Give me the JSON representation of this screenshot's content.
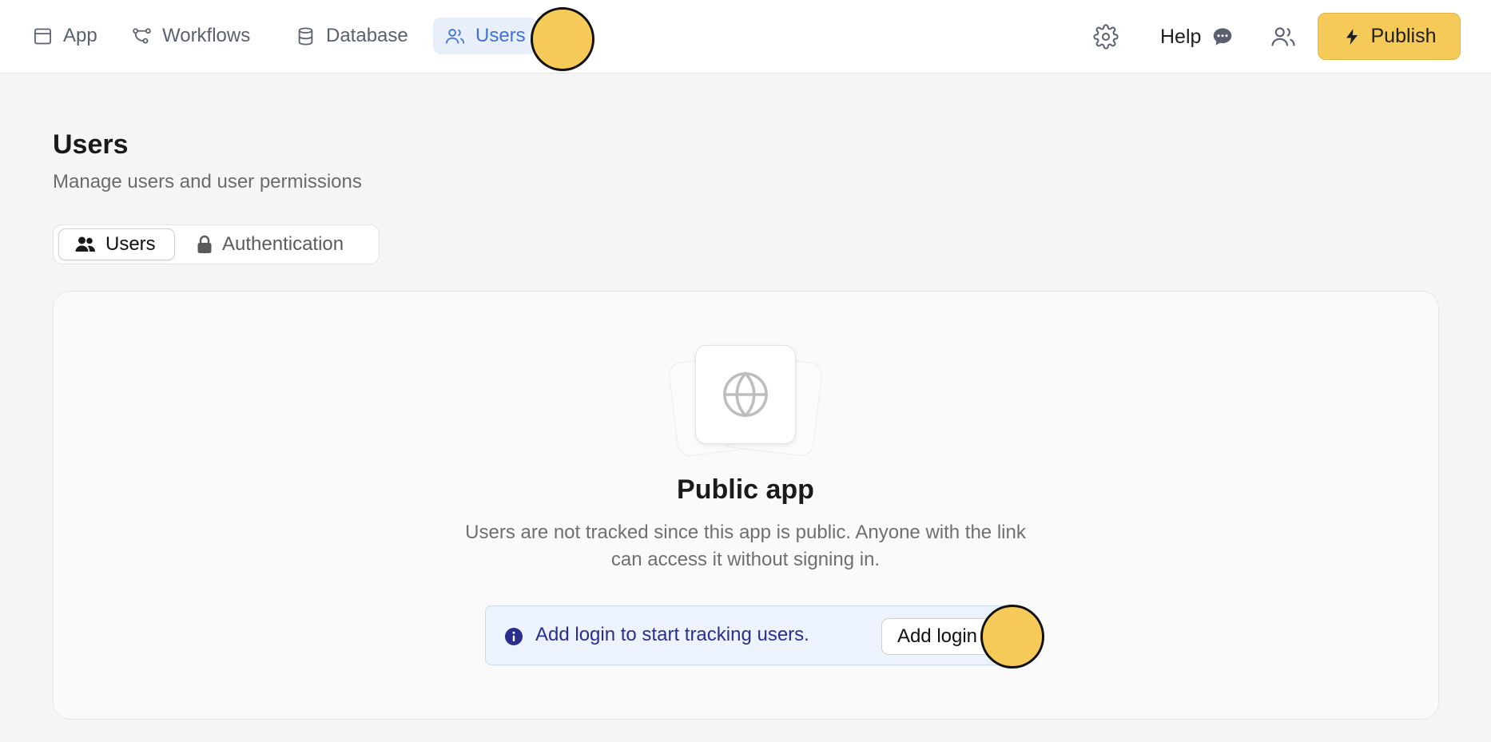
{
  "nav": {
    "app": "App",
    "workflows": "Workflows",
    "database": "Database",
    "users": "Users",
    "active": "users"
  },
  "toolbar": {
    "help": "Help",
    "publish": "Publish",
    "icons": [
      "gear-icon",
      "chat-bubble-icon",
      "people-icon",
      "lightning-icon"
    ]
  },
  "page": {
    "title": "Users",
    "subtitle": "Manage users and user permissions"
  },
  "tabs": [
    {
      "label": "Users",
      "icon": "users-icon",
      "active": true
    },
    {
      "label": "Authentication",
      "icon": "lock-icon",
      "active": false
    }
  ],
  "empty_state": {
    "icon": "globe-icon",
    "title": "Public app",
    "description": "Users are not tracked since this app is public. Anyone with the link can access it without signing in."
  },
  "notice": {
    "icon": "info-icon",
    "text": "Add login to start tracking users.",
    "button": "Add login"
  },
  "colors": {
    "accent": "#f5ca58",
    "active_nav": "#3f73d8",
    "active_nav_bg": "#e8eefa",
    "notice_bg": "#edf3fc",
    "notice_text": "#2a2f8f"
  }
}
